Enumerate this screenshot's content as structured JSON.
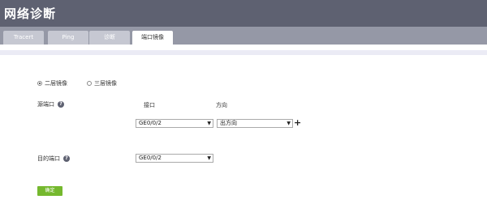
{
  "header": {
    "title": "网络诊断"
  },
  "tabs": [
    {
      "label": "Tracert"
    },
    {
      "label": "Ping"
    },
    {
      "label": "诊断"
    },
    {
      "label": "端口镜像",
      "active": true
    }
  ],
  "mirror_mode": {
    "options": [
      {
        "label": "二层镜像",
        "selected": true
      },
      {
        "label": "三层镜像",
        "selected": false
      }
    ]
  },
  "source_port": {
    "label": "源端口",
    "help": "?",
    "col_port": "接口",
    "col_direction": "方向",
    "port_value": "GE0/0/2",
    "direction_value": "出方向",
    "add_symbol": "+"
  },
  "dest_port": {
    "label": "目的端口",
    "help": "?",
    "port_value": "GE0/0/2"
  },
  "confirm_button": "确定",
  "colors": {
    "header": "#5e6171",
    "tabbar": "#9598a6",
    "confirm": "#75b82e"
  }
}
